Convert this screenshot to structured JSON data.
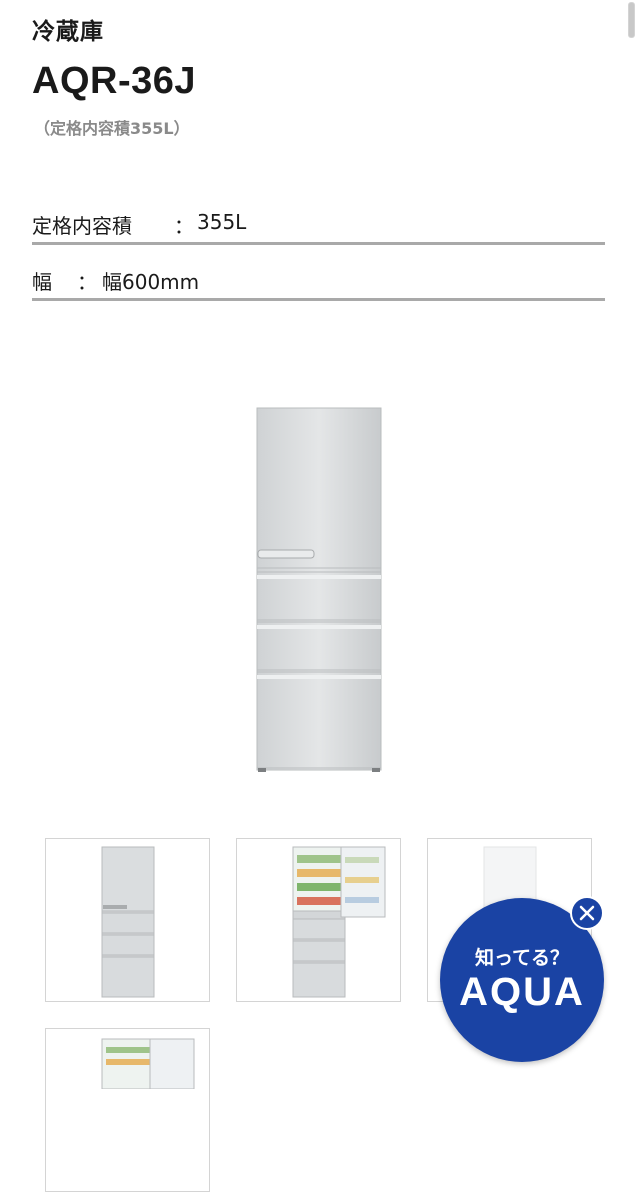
{
  "product": {
    "category": "冷蔵庫",
    "model": "AQR-36J",
    "capacity_note": "（定格内容積355L）"
  },
  "specs": [
    {
      "label": "定格内容積",
      "separator": "：",
      "value": "355L"
    },
    {
      "label": "幅",
      "separator": "：",
      "value": "幅600mm"
    }
  ],
  "gallery": {
    "main_image": "refrigerator-front-silver",
    "thumbnails": [
      {
        "name": "refrigerator-closed"
      },
      {
        "name": "refrigerator-open"
      },
      {
        "name": "refrigerator-white"
      },
      {
        "name": "refrigerator-open-interior"
      }
    ]
  },
  "badge": {
    "line1": "知ってる？",
    "line2": "AQUA",
    "close_icon": "close-icon",
    "color": "#1a43a4"
  }
}
